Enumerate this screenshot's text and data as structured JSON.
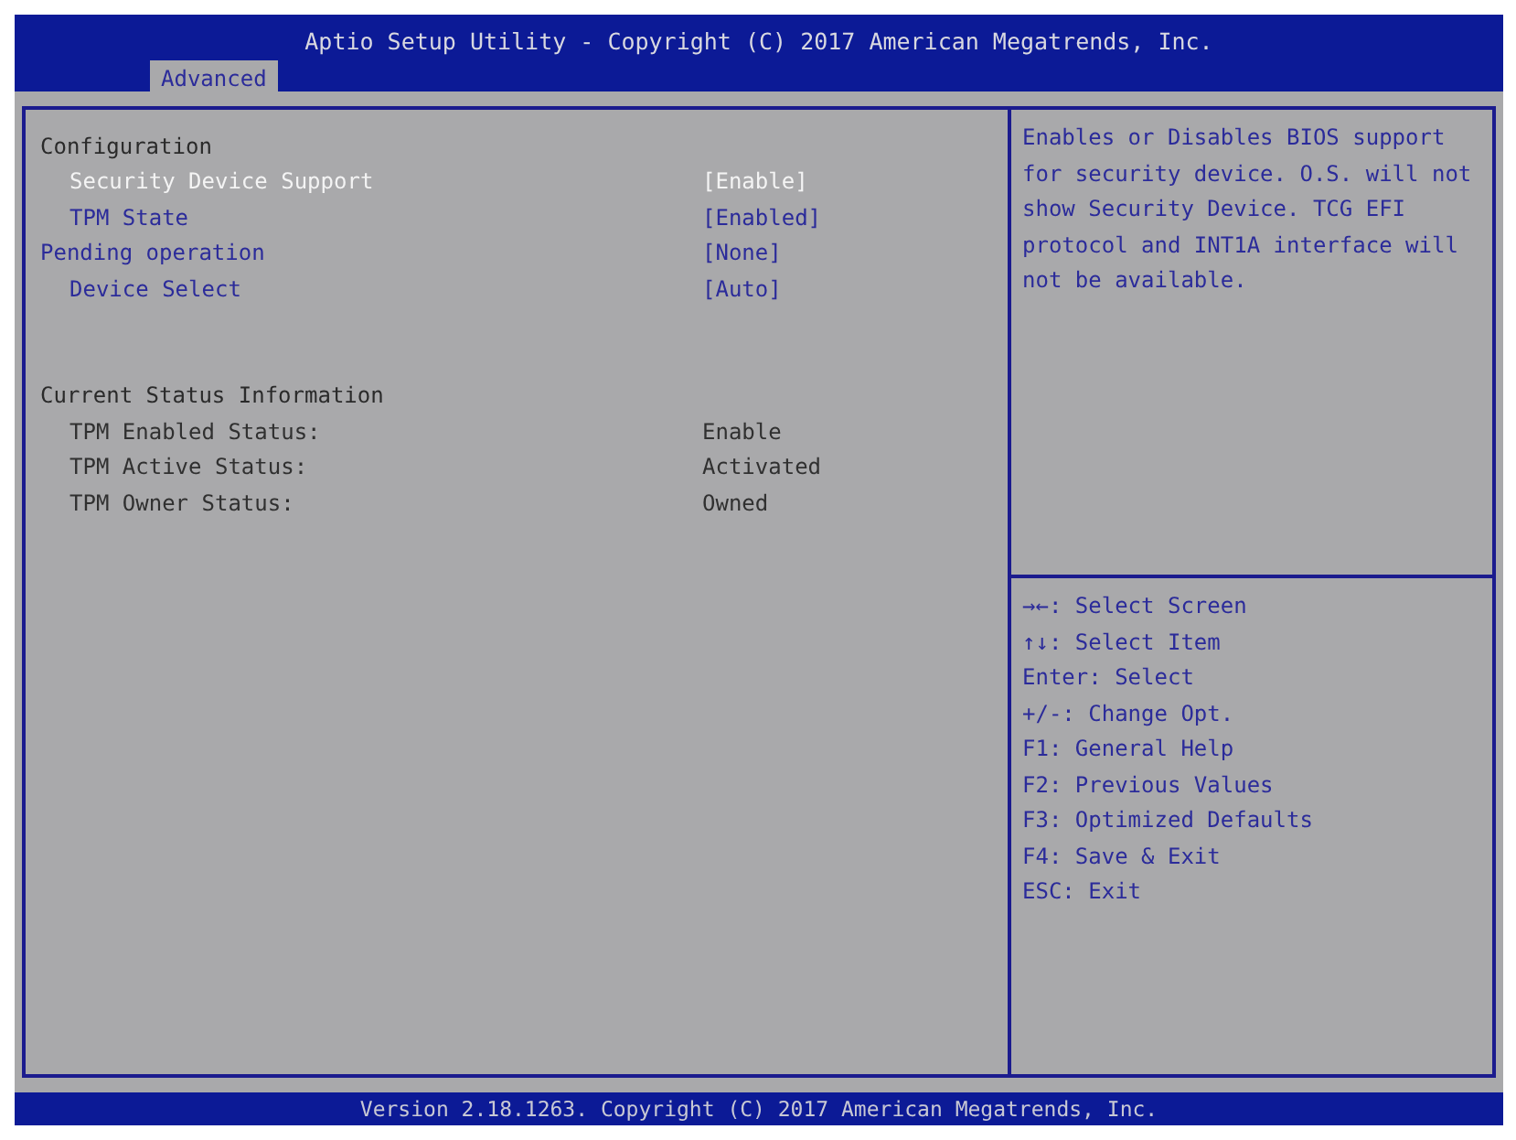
{
  "title": "Aptio Setup Utility - Copyright (C) 2017 American Megatrends, Inc.",
  "tabs": [
    {
      "label": "Advanced",
      "selected": true
    }
  ],
  "items": [
    {
      "kind": "heading",
      "label": "Configuration",
      "children": [
        {
          "kind": "setting",
          "label": "Security Device Support",
          "value": "[Enable]",
          "selected": true
        },
        {
          "kind": "setting",
          "label": "TPM State",
          "value": "[Enabled]",
          "selected": false
        }
      ]
    },
    {
      "kind": "setting",
      "label": "Pending operation",
      "value": "[None]",
      "selected": false,
      "children": [
        {
          "kind": "setting",
          "label": "Device Select",
          "value": "[Auto]",
          "selected": false
        }
      ]
    },
    {
      "kind": "spacer"
    },
    {
      "kind": "heading",
      "label": "Current Status Information",
      "children": [
        {
          "kind": "info",
          "label": "TPM Enabled Status:",
          "value": "Enable"
        },
        {
          "kind": "info",
          "label": "TPM Active Status:",
          "value": "Activated"
        },
        {
          "kind": "info",
          "label": "TPM Owner Status:",
          "value": "Owned"
        }
      ]
    }
  ],
  "help_text": "Enables or Disables BIOS support for security device. O.S. will not show Security Device. TCG EFI protocol and INT1A interface will not be available.",
  "key_help": [
    "→←: Select Screen",
    "↑↓: Select Item",
    "Enter: Select",
    "+/-: Change Opt.",
    "F1: General Help",
    "F2: Previous Values",
    "F3: Optimized Defaults",
    "F4: Save & Exit",
    "ESC: Exit"
  ],
  "footer": "Version 2.18.1263. Copyright (C) 2017 American Megatrends, Inc."
}
